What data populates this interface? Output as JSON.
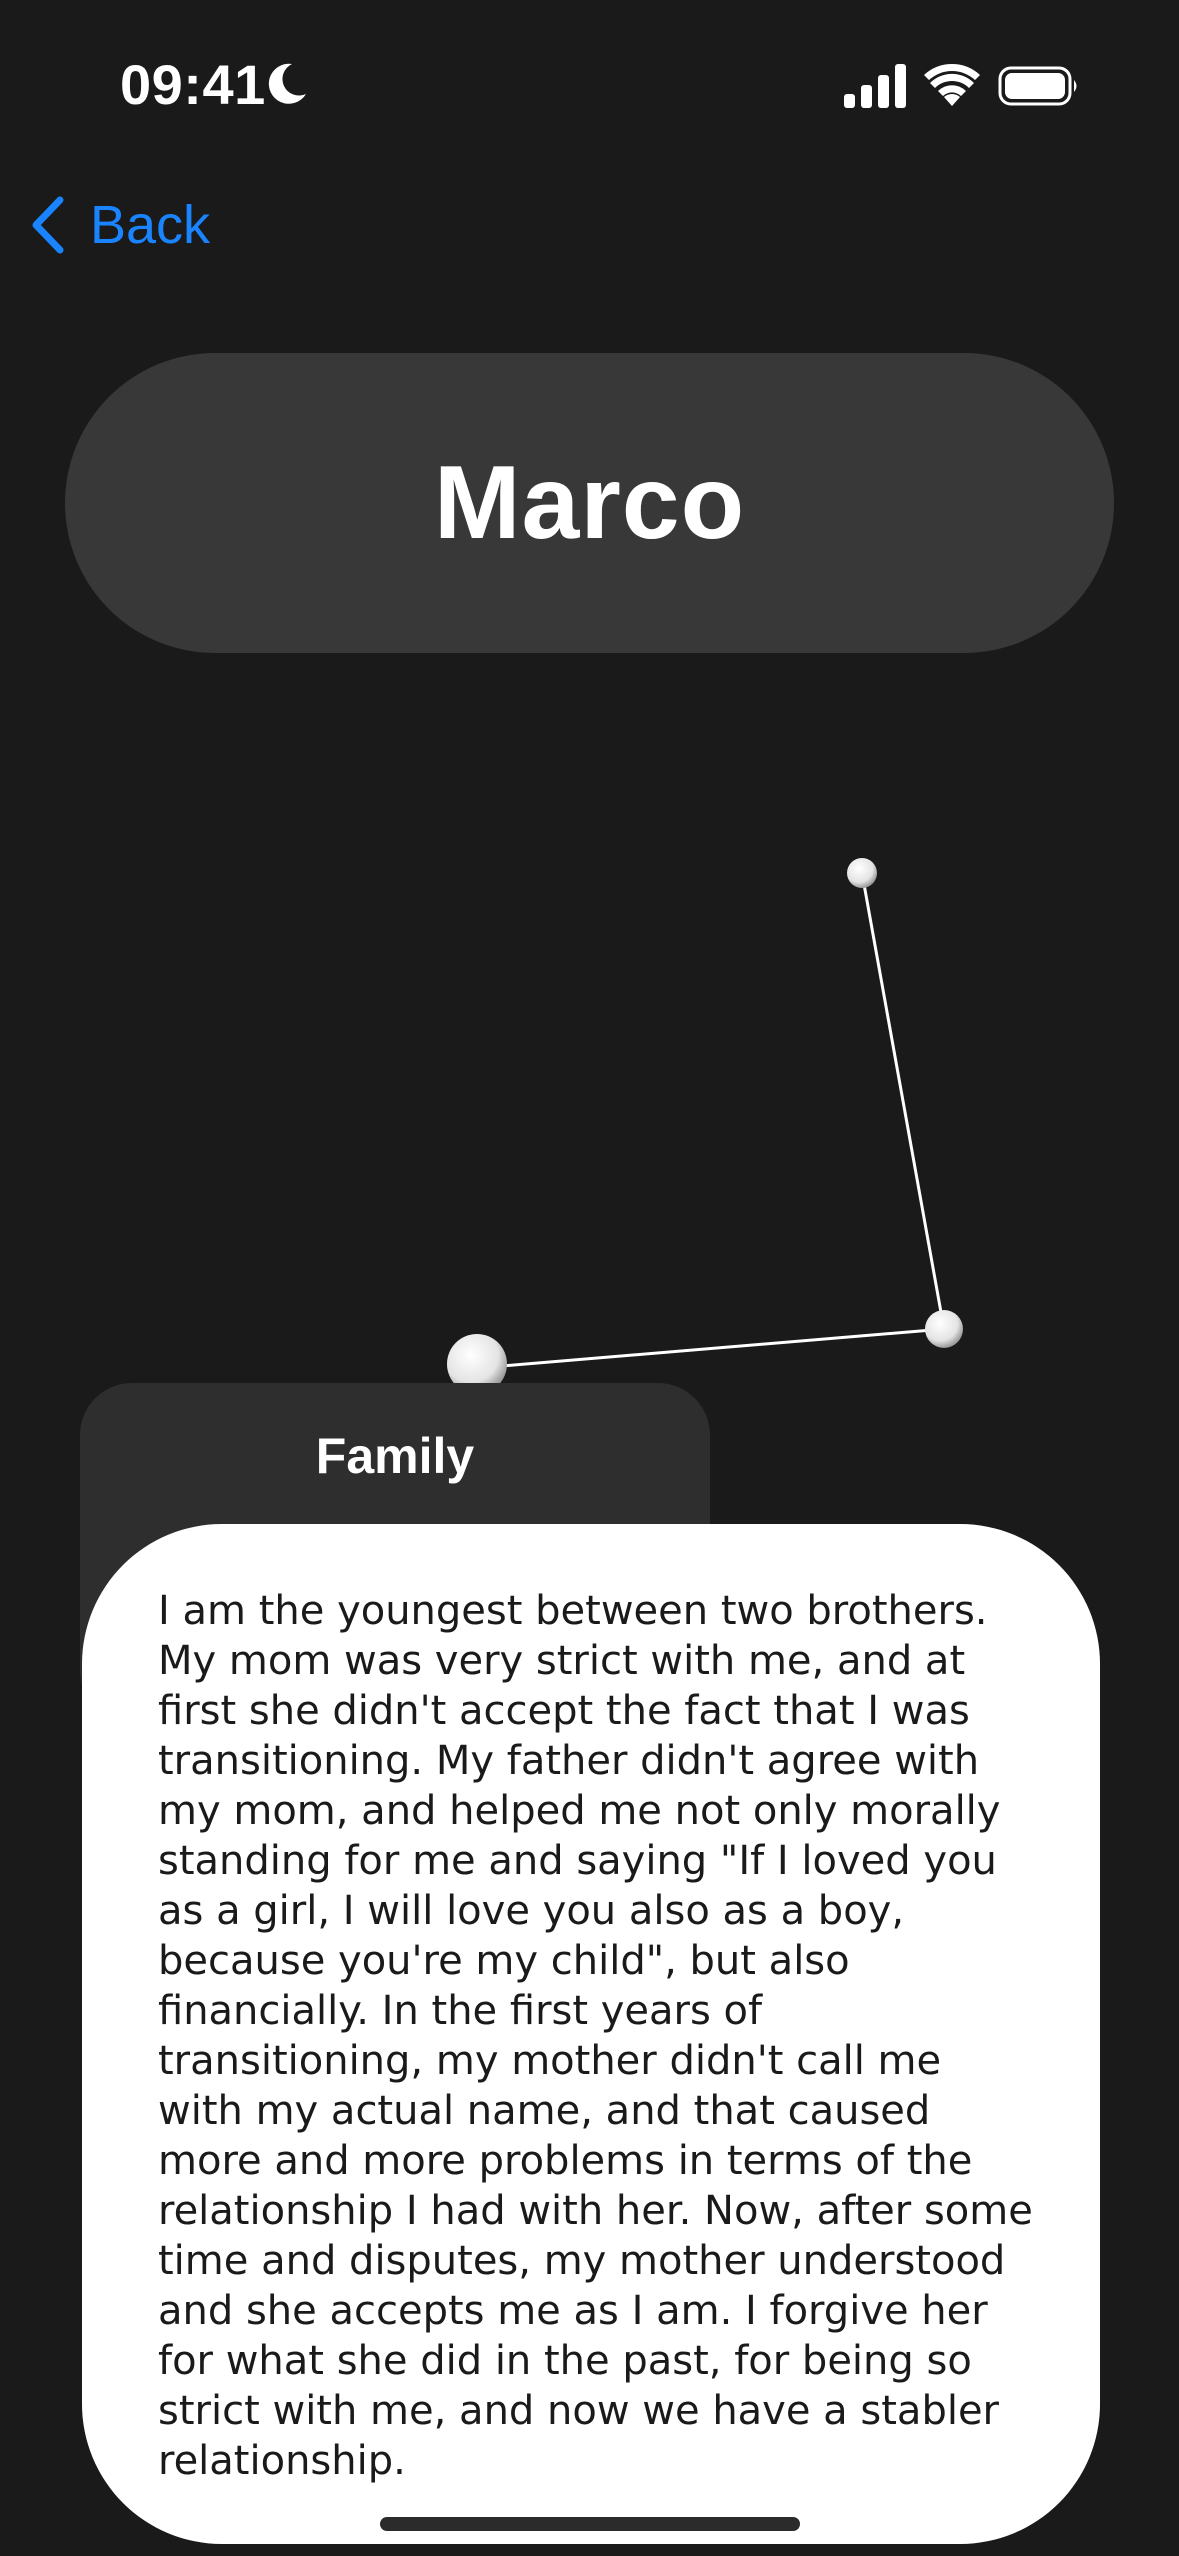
{
  "status_bar": {
    "time": "09:41",
    "focus_icon": "moon-icon",
    "signal_icon": "cellular-signal-icon",
    "wifi_icon": "wifi-icon",
    "battery_icon": "battery-icon"
  },
  "nav": {
    "back_label": "Back",
    "back_icon": "chevron-left-icon",
    "accent_color": "#1a84ff"
  },
  "header": {
    "title": "Marco"
  },
  "graph": {
    "node_color": "#f2f2f2",
    "edge_color": "#ffffff"
  },
  "family_card": {
    "label": "Family"
  },
  "story": {
    "text": "I am the youngest between two brothers. My mom was very strict with me, and at first she didn't accept the fact that I was transitioning. My father didn't agree with my mom, and helped me not only morally standing for me and saying \"If I loved you as a girl, I will love you also as a boy, because you're my child\", but also financially. In the first years of transitioning, my mother didn't call me with my actual name, and that caused more and more problems in terms of the relationship I had with her. Now, after some time and disputes, my mother understood and she accepts me as I am. I forgive her for what she did in the past, for being so strict with me, and now we have a stabler relationship."
  },
  "colors": {
    "background": "#1a1a1a",
    "pill": "#383838",
    "card": "#2e2e2e",
    "sheet": "#ffffff"
  }
}
